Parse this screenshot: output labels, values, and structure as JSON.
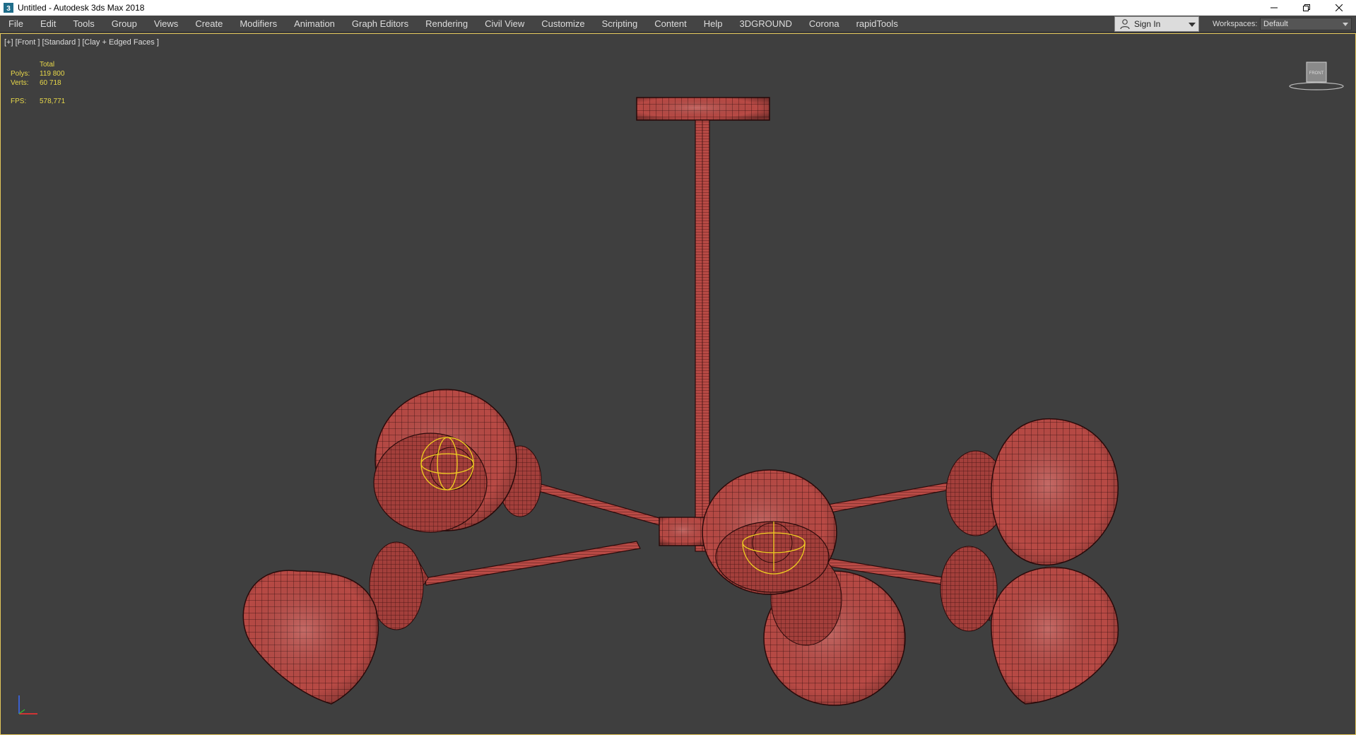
{
  "window": {
    "title": "Untitled - Autodesk 3ds Max 2018"
  },
  "menu": {
    "items": [
      {
        "label": "File"
      },
      {
        "label": "Edit"
      },
      {
        "label": "Tools"
      },
      {
        "label": "Group"
      },
      {
        "label": "Views"
      },
      {
        "label": "Create"
      },
      {
        "label": "Modifiers"
      },
      {
        "label": "Animation"
      },
      {
        "label": "Graph Editors"
      },
      {
        "label": "Rendering"
      },
      {
        "label": "Civil View"
      },
      {
        "label": "Customize"
      },
      {
        "label": "Scripting"
      },
      {
        "label": "Content"
      },
      {
        "label": "Help"
      },
      {
        "label": "3DGROUND"
      },
      {
        "label": "Corona"
      },
      {
        "label": "rapidTools"
      }
    ]
  },
  "account": {
    "sign_in_label": "Sign In",
    "user_icon": "user-icon"
  },
  "workspaces": {
    "label": "Workspaces:",
    "selected": "Default"
  },
  "viewport": {
    "label": "[+] [Front ] [Standard ] [Clay + Edged Faces ]",
    "stats": {
      "header": "Total",
      "polys_label": "Polys:",
      "polys_value": "119 800",
      "verts_label": "Verts:",
      "verts_value": "60 718",
      "fps_label": "FPS:",
      "fps_value": "578,771"
    },
    "viewcube_face": "FRONT"
  },
  "colors": {
    "accent_border": "#e3c75a",
    "stats_text": "#e8d84a",
    "mesh_fill": "#b84a45",
    "mesh_wire": "#3a0f0f",
    "selection": "#f0d020",
    "viewport_bg": "#3f3f3f"
  }
}
